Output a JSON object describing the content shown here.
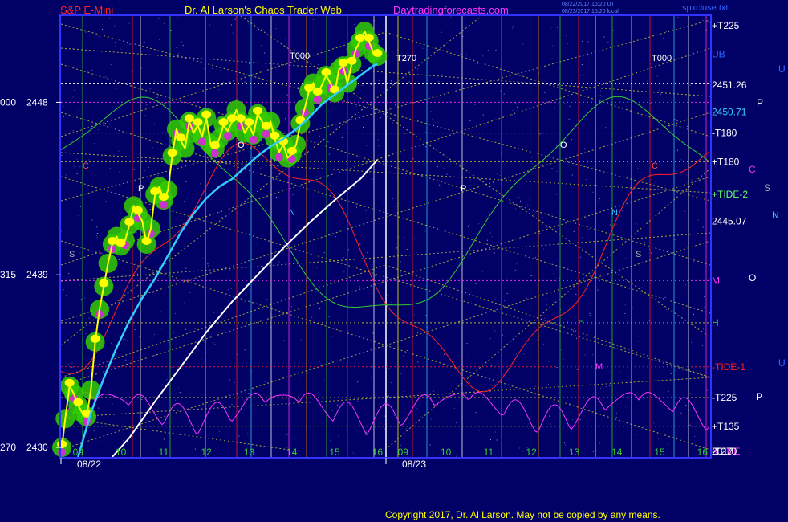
{
  "header": {
    "instrument": "S&P E-Mini",
    "site": "Dr. Al Larson's Chaos Trader Web",
    "url": "Daytradingforecasts.com",
    "timestamp_1": "08/22/2017 16:20 UT",
    "timestamp_2": "08/23/2017 15:20 local",
    "filename": "spxclose.txt"
  },
  "copyright": "Copyright 2017, Dr. Al Larson. May not be copied by any means.",
  "colors": {
    "background": "#000066",
    "frame": "#3333ff",
    "price": "#ffff00",
    "ema": "#33ccff",
    "trend": "#ffffff",
    "xtide": "#ff33ff",
    "tide": "#ff2222",
    "tide2": "#33cc33",
    "ma_glow": "#33cc00"
  },
  "chart_data": {
    "type": "line",
    "title": "S&P E-Mini",
    "ylim": [
      2429.5,
      2452.5
    ],
    "xlim": [
      8.6,
      16.2
    ],
    "dates": [
      "08/22",
      "08/23"
    ],
    "hour_ticks": [
      "09",
      "10",
      "11",
      "12",
      "13",
      "14",
      "15",
      "16",
      "09",
      "10",
      "11",
      "12",
      "13",
      "14",
      "15",
      "16"
    ],
    "price_axis_labels": [
      {
        "left": "000",
        "price": "2448",
        "value": 2448
      },
      {
        "left": "315",
        "price": "2439",
        "value": 2439
      },
      {
        "left": "270",
        "price": "2430",
        "value": 2430
      }
    ],
    "right_labels": [
      {
        "text": "+T225",
        "value": 2452.0,
        "color": "#ffffff"
      },
      {
        "text": "UB",
        "value": 2450.5,
        "color": "#3366ff"
      },
      {
        "text": "2451.26",
        "value": 2448.9,
        "color": "#ffffff"
      },
      {
        "text": "2450.71",
        "value": 2447.5,
        "color": "#33ccff"
      },
      {
        "text": "-T180",
        "value": 2446.4,
        "color": "#ffffff"
      },
      {
        "text": "+T180",
        "value": 2444.9,
        "color": "#ffffff"
      },
      {
        "text": "+TIDE-2",
        "value": 2443.2,
        "color": "#66ff66"
      },
      {
        "text": "2445.07",
        "value": 2441.8,
        "color": "#ffffff"
      },
      {
        "text": "M",
        "value": 2438.7,
        "color": "#ff33ff"
      },
      {
        "text": "H",
        "value": 2436.5,
        "color": "#33cc33"
      },
      {
        "text": "-TIDE-1",
        "value": 2434.2,
        "color": "#ff2222"
      },
      {
        "text": "-T225",
        "value": 2432.6,
        "color": "#ffffff"
      },
      {
        "text": "+T135",
        "value": 2431.1,
        "color": "#ffffff"
      },
      {
        "text": "XTIDE",
        "value": 2427.4,
        "color": "#ff33ff"
      },
      {
        "text": "-T270",
        "value": 2422.6,
        "color": "#ffffff"
      },
      {
        "text": "2017",
        "value": 2421.7,
        "color": "#ffffff"
      }
    ],
    "far_right_letters": [
      {
        "text": "P",
        "color": "#ffffff"
      },
      {
        "text": "C",
        "color": "#ff33ff"
      },
      {
        "text": "S",
        "color": "#aaaaaa"
      },
      {
        "text": "N",
        "color": "#33ccff"
      },
      {
        "text": "O",
        "color": "#ffffff"
      },
      {
        "text": "U",
        "color": "#3366ff"
      },
      {
        "text": "P",
        "color": "#ffffff"
      },
      {
        "text": "U",
        "color": "#3366ff"
      }
    ],
    "chart_markers": [
      {
        "text": "T000",
        "color": "#ffffff"
      },
      {
        "text": "T270",
        "color": "#ffffff"
      },
      {
        "text": "T000",
        "color": "#ffffff"
      },
      {
        "text": "O",
        "color": "#ffffff"
      },
      {
        "text": "P",
        "color": "#ffffff"
      },
      {
        "text": "C",
        "color": "#ff4444"
      },
      {
        "text": "N",
        "color": "#33ccff"
      },
      {
        "text": "S",
        "color": "#aaaaaa"
      },
      {
        "text": "P",
        "color": "#ffffff"
      },
      {
        "text": "O",
        "color": "#ffffff"
      },
      {
        "text": "C",
        "color": "#ff4444"
      },
      {
        "text": "N",
        "color": "#33ccff"
      },
      {
        "text": "S",
        "color": "#aaaaaa"
      },
      {
        "text": "M",
        "color": "#ff33ff"
      },
      {
        "text": "H",
        "color": "#33cc33"
      }
    ],
    "series": [
      {
        "name": "price",
        "color": "#ffff00",
        "x": [
          8.62,
          8.7,
          8.8,
          8.9,
          9.0,
          9.1,
          9.2,
          9.3,
          9.4,
          9.5,
          9.6,
          9.7,
          9.8,
          9.9,
          10.0,
          10.1,
          10.2,
          10.3,
          10.4,
          10.5,
          10.6,
          10.7,
          10.8,
          10.9,
          11.0,
          11.1,
          11.2,
          11.3,
          11.4,
          11.5,
          11.6,
          11.7,
          11.8,
          11.9,
          12.0,
          12.1,
          12.2,
          12.3,
          12.4,
          12.5,
          12.6,
          12.7,
          12.8,
          12.9,
          13.0,
          13.1,
          13.2,
          13.3,
          13.4,
          13.5,
          13.6,
          13.7,
          13.8,
          13.9,
          14.0,
          14.1,
          14.2,
          14.3,
          14.4,
          14.5,
          14.6,
          14.7,
          14.8,
          14.9,
          15.0,
          15.1,
          15.2,
          15.3,
          15.4,
          15.5,
          15.6,
          15.7,
          15.8,
          15.9,
          16.0
        ],
        "y": [
          2430.0,
          2431.5,
          2433.2,
          2432.8,
          2432.2,
          2431.8,
          2431.6,
          2433.0,
          2435.5,
          2437.2,
          2438.4,
          2439.6,
          2440.6,
          2441.0,
          2440.5,
          2440.8,
          2441.6,
          2442.6,
          2442.2,
          2441.8,
          2440.6,
          2441.4,
          2443.2,
          2443.6,
          2442.9,
          2443.4,
          2445.2,
          2446.6,
          2446.0,
          2445.6,
          2447.0,
          2446.4,
          2446.8,
          2446.2,
          2447.2,
          2445.8,
          2445.6,
          2446.1,
          2446.8,
          2446.5,
          2447.0,
          2447.6,
          2447.0,
          2446.4,
          2446.8,
          2446.3,
          2447.4,
          2447.0,
          2446.6,
          2447.0,
          2446.1,
          2445.4,
          2445.8,
          2445.1,
          2445.3,
          2445.8,
          2446.9,
          2447.7,
          2448.6,
          2449.0,
          2448.4,
          2448.9,
          2449.4,
          2449.0,
          2448.5,
          2449.7,
          2449.9,
          2449.0,
          2450.0,
          2450.8,
          2451.2,
          2451.7,
          2451.2,
          2450.6,
          2450.4
        ]
      },
      {
        "name": "ema",
        "color": "#33ccff",
        "x": [
          9.0,
          9.3,
          9.6,
          9.9,
          10.2,
          10.5,
          10.8,
          11.1,
          11.4,
          11.7,
          12.0,
          12.3,
          12.6,
          12.9,
          13.2,
          13.5,
          13.8,
          14.1,
          14.4,
          14.7,
          15.0,
          15.3,
          15.6,
          15.9,
          16.0
        ],
        "y": [
          2429.5,
          2431.8,
          2433.6,
          2435.2,
          2436.6,
          2437.8,
          2438.8,
          2440.0,
          2441.2,
          2442.2,
          2443.0,
          2443.6,
          2444.0,
          2444.6,
          2445.2,
          2445.7,
          2446.1,
          2446.6,
          2447.2,
          2447.9,
          2448.4,
          2448.9,
          2449.4,
          2449.9,
          2450.0
        ]
      },
      {
        "name": "trend",
        "color": "#ffffff",
        "x": [
          9.8,
          10.2,
          10.8,
          11.4,
          12.0,
          12.6,
          13.2,
          13.8,
          14.4,
          15.0,
          15.6,
          16.0
        ],
        "y": [
          2429.5,
          2430.5,
          2432.4,
          2434.2,
          2436.0,
          2437.6,
          2439.0,
          2440.4,
          2441.7,
          2442.9,
          2444.0,
          2445.0
        ]
      }
    ]
  }
}
